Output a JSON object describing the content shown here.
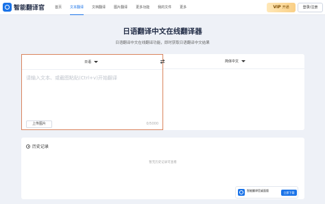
{
  "header": {
    "logo_text": "智能翻译官",
    "nav": [
      "首页",
      "文本翻译",
      "文档翻译",
      "图片翻译",
      "更多功能",
      "我的文件",
      "更多"
    ],
    "active_index": 1,
    "vip_label": "VIP",
    "vip_sub": "开通",
    "login_label": "登录/注册"
  },
  "hero": {
    "title": "日语翻译中文在线翻译器",
    "subtitle": "日语翻译中文在线翻译功能，即时获取日语翻译中文结果"
  },
  "translator": {
    "source_lang": "日语",
    "target_lang": "简体中文",
    "placeholder": "请输入文本、或截图粘贴(Ctrl+v)开始翻译",
    "upload_label": "上传图片",
    "counter": "0/5000"
  },
  "history": {
    "title": "历史记录",
    "empty": "暂无历史记录可查看"
  },
  "promo": {
    "title": "智能翻译官桌面版",
    "subtitle": "",
    "button": "立即下载"
  },
  "colors": {
    "accent": "#1a73e8",
    "highlight_border": "#d9825b",
    "background": "#eef1f7"
  }
}
